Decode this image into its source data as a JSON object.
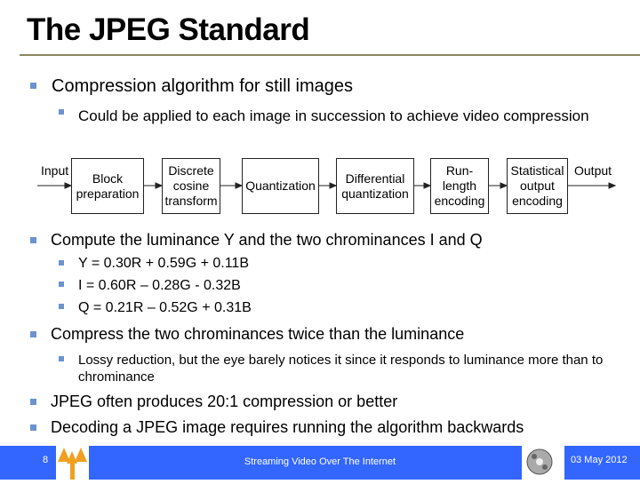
{
  "title": "The JPEG Standard",
  "bullets": [
    {
      "text": "Compression algorithm for still images",
      "sub": [
        "Could be applied to each image in succession to achieve video compression"
      ]
    },
    {
      "text": "Compute the luminance Y and the two chrominances I and Q",
      "sub": [
        "Y = 0.30R + 0.59G + 0.11B",
        "I = 0.60R – 0.28G - 0.32B",
        "Q = 0.21R – 0.52G + 0.31B"
      ]
    },
    {
      "text": "Compress the two chrominances twice than the luminance",
      "sub": [
        "Lossy reduction, but the eye barely notices it since it responds to luminance more than to chrominance"
      ]
    },
    {
      "text": "JPEG often produces 20:1 compression or better"
    },
    {
      "text": "Decoding a JPEG image requires running the algorithm backwards"
    }
  ],
  "diagram": {
    "input": "Input",
    "output": "Output",
    "stages": [
      "Block\npreparation",
      "Discrete\ncosine\ntransform",
      "Quantization",
      "Differential\nquantization",
      "Run-\nlength\nencoding",
      "Statistical\noutput\nencoding"
    ]
  },
  "footer": {
    "page": "8",
    "center": "Streaming Video Over The Internet",
    "date": "03 May 2012",
    "colors": {
      "bar": "#3366ff"
    }
  }
}
